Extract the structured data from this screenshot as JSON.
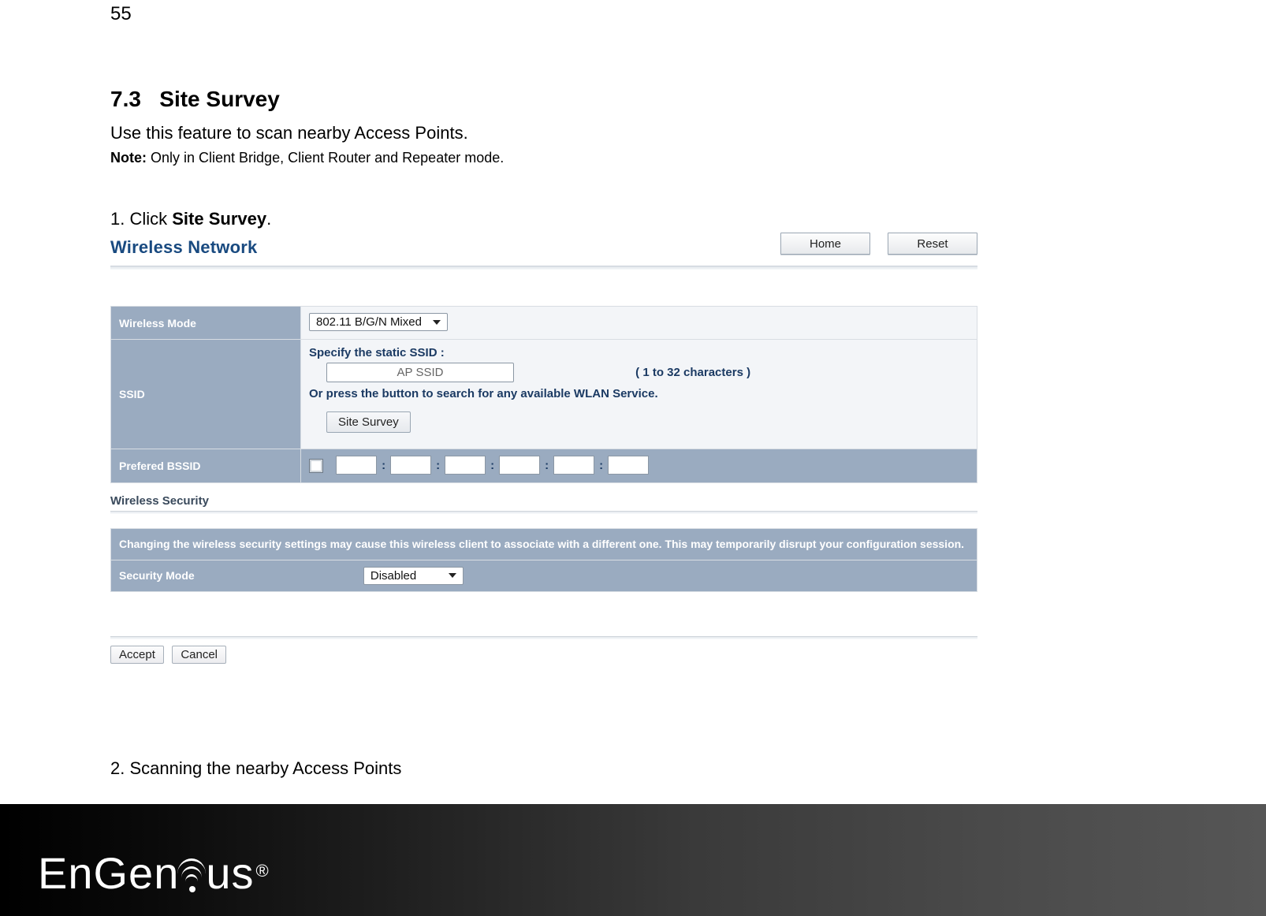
{
  "page_number": "55",
  "section": {
    "number": "7.3",
    "title": "Site Survey"
  },
  "description": "Use this feature to scan nearby Access Points.",
  "note_label": "Note:",
  "note_text": " Only in Client Bridge, Client Router and Repeater mode.",
  "step1_prefix": "1. Click ",
  "step1_bold": "Site Survey",
  "step1_suffix": ".",
  "panel": {
    "title": "Wireless Network",
    "home": "Home",
    "reset": "Reset",
    "rows": {
      "wireless_mode_label": "Wireless Mode",
      "wireless_mode_value": "802.11 B/G/N Mixed",
      "ssid_label": "SSID",
      "ssid_help1": "Specify the static SSID  :",
      "ssid_placeholder": "AP SSID",
      "ssid_chars": "( 1 to 32 characters )",
      "ssid_help2": "Or press the button to search for any available WLAN Service.",
      "site_survey_btn": "Site Survey",
      "bssid_label": "Prefered BSSID"
    },
    "security_header": "Wireless Security",
    "security_warning": "Changing the wireless security settings may cause this wireless client to associate with a different one. This may temporarily disrupt your configuration session.",
    "security_mode_label": "Security Mode",
    "security_mode_value": "Disabled",
    "accept": "Accept",
    "cancel": "Cancel"
  },
  "step2": "2. Scanning the nearby Access Points",
  "logo_text": "EnGenius"
}
